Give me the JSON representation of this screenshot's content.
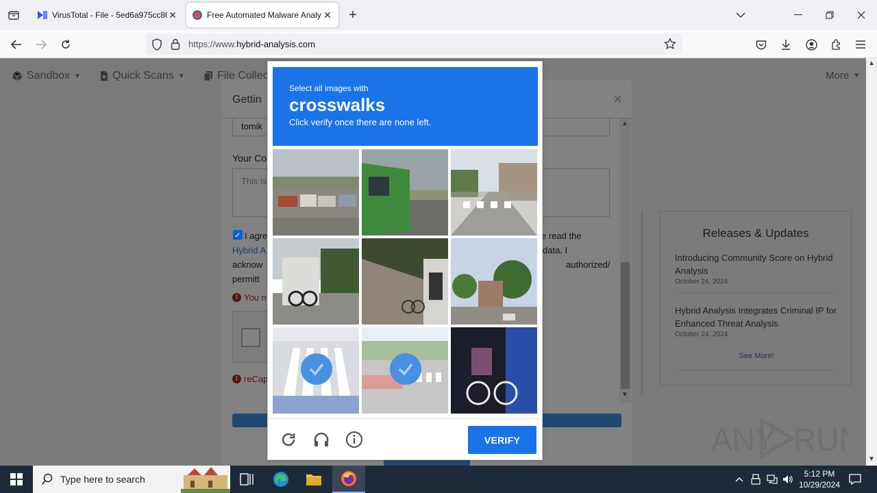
{
  "browser": {
    "tabs": [
      {
        "title": "VirusTotal - File - 5ed6a975cc80",
        "active": false
      },
      {
        "title": "Free Automated Malware Analy",
        "active": true
      }
    ],
    "url_prefix": "https://www.",
    "url_host": "hybrid-analysis.com"
  },
  "site_nav": {
    "items": [
      "Sandbox",
      "Quick Scans",
      "File Collec"
    ],
    "more": "More"
  },
  "modal": {
    "title": "Gettin",
    "name_value": "tomik",
    "comment_label": "Your Co",
    "comment_placeholder": "This is",
    "agree_line1_left": "I agre",
    "agree_line1_right": "e read the",
    "agree_line2_left": "Hybrid A",
    "agree_line2_right": "data. I",
    "agree_line3_left": "acknow",
    "agree_line3_right": "authorized/",
    "agree_line4_left": "permitt",
    "error1": "You n",
    "error2": "reCap"
  },
  "releases": {
    "title": "Releases & Updates",
    "items": [
      {
        "headline": "Introducing Community Score on Hybrid Analysis",
        "date": "October 24, 2024"
      },
      {
        "headline": "Hybrid Analysis Integrates Criminal IP for Enhanced Threat Analysis",
        "date": "October 24, 2024"
      }
    ],
    "see_more": "See More!"
  },
  "captcha": {
    "prompt_line1": "Select all images with",
    "target": "crosswalks",
    "prompt_line3": "Click verify once there are none left.",
    "verify_label": "VERIFY",
    "selected_tiles": [
      6,
      7
    ],
    "accent": "#1a73e8"
  },
  "watermark": {
    "text_left": "ANY",
    "text_right": "RUN"
  },
  "taskbar": {
    "search_placeholder": "Type here to search",
    "time": "5:12 PM",
    "date": "10/29/2024"
  }
}
